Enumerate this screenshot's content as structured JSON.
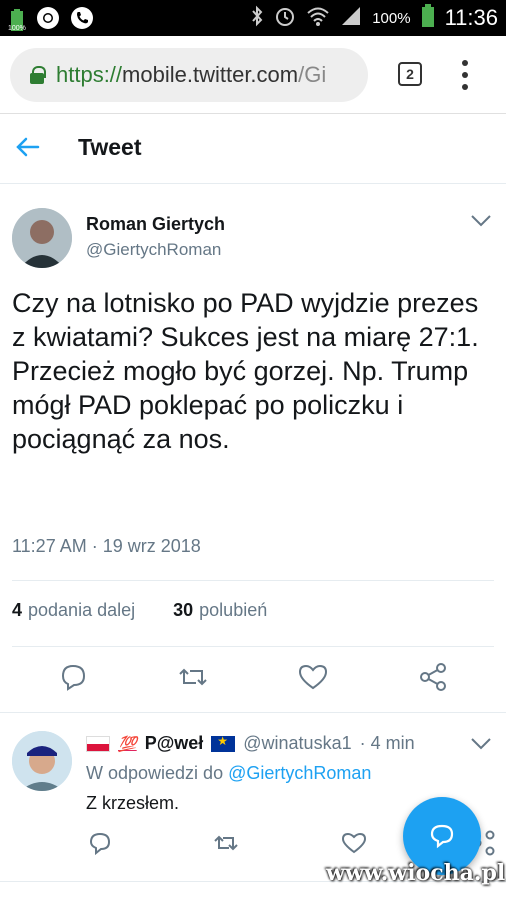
{
  "status_bar": {
    "battery_small": "100%",
    "battery": "100%",
    "time": "11:36"
  },
  "browser": {
    "url_scheme": "https://",
    "url_host": "mobile.twitter.com",
    "url_rest": "/Gi",
    "tab_count": "2"
  },
  "header": {
    "back_icon": "back-arrow-icon",
    "title": "Tweet"
  },
  "tweet": {
    "author_name": "Roman Giertych",
    "author_handle": "@GiertychRoman",
    "text": "Czy na lotnisko po PAD wyjdzie prezes z kwiatami? Sukces jest na miarę 27:1. Przecież mogło być gorzej. Np. Trump mógł PAD poklepać po policzku i pociągnąć za nos.",
    "timestamp": "11:27 AM · 19 wrz 2018",
    "retweets_count": "4",
    "retweets_label": "podania dalej",
    "likes_count": "30",
    "likes_label": "polubień"
  },
  "reply": {
    "emoji_100": "💯",
    "author_name": "P@weł",
    "author_handle": "@winatuska1",
    "time": "· 4 min",
    "reply_to_prefix": "W odpowiedzi do",
    "reply_to_handle": "@GiertychRoman",
    "text": "Z krzesłem."
  },
  "watermark": "www.wiocha.pl",
  "colors": {
    "accent": "#1da1f2",
    "text": "#14171a",
    "secondary": "#657786"
  }
}
